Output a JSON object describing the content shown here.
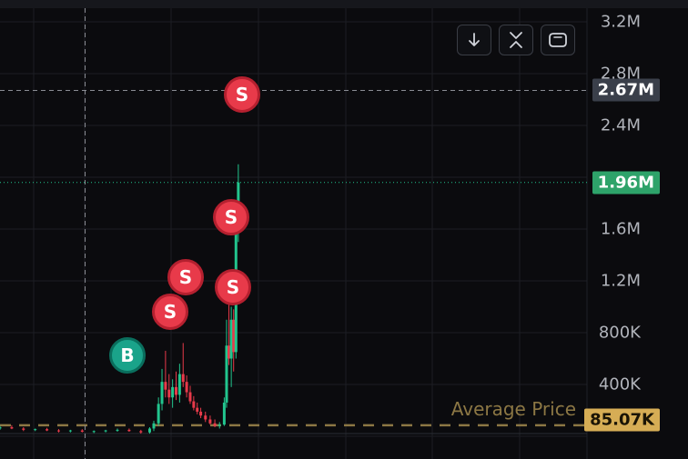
{
  "toolbar": {
    "buttons": [
      {
        "name": "scroll-down-button",
        "icon": "arrow-down-icon"
      },
      {
        "name": "collapse-button",
        "icon": "collapse-chevrons-icon"
      },
      {
        "name": "fullscreen-button",
        "icon": "fullscreen-frame-icon"
      }
    ]
  },
  "colors": {
    "background": "#0b0b0e",
    "grid": "#1c1e24",
    "up": "#22c58e",
    "down": "#e83a4a",
    "sell_marker": "#e83a4a",
    "buy_marker": "#1aa38a",
    "current_price_tag": "#2ea36a",
    "crosshair_tag": "#3a3f4a",
    "average_tag": "#d6ad55",
    "average_line": "#8c7744"
  },
  "tags": {
    "crosshair_price": "2.67M",
    "current_price": "1.96M",
    "average_price": "85.07K",
    "average_label": "Average Price"
  },
  "chart_data": {
    "type": "candlestick",
    "y_axis": {
      "ticks": [
        {
          "label": "3.2M",
          "value": 3200000
        },
        {
          "label": "2.8M",
          "value": 2800000
        },
        {
          "label": "2.4M",
          "value": 2400000
        },
        {
          "label": "1.6M",
          "value": 1600000
        },
        {
          "label": "1.2M",
          "value": 1200000
        },
        {
          "label": "800K",
          "value": 800000
        },
        {
          "label": "400K",
          "value": 400000
        }
      ],
      "range": [
        0,
        3250000
      ]
    },
    "grid": true,
    "horizontal_lines": [
      {
        "kind": "crosshair",
        "value": 2670000
      },
      {
        "kind": "current",
        "value": 1960000
      },
      {
        "kind": "average",
        "value": 85070
      }
    ],
    "crosshair_x_fraction": 0.145,
    "markers": [
      {
        "type": "sell",
        "label": "S",
        "index": 0.41,
        "value": 2670000
      },
      {
        "type": "sell",
        "label": "S",
        "index": 0.392,
        "value": 1700000
      },
      {
        "type": "sell",
        "label": "S",
        "index": 0.395,
        "value": 1010000
      },
      {
        "type": "sell",
        "label": "S",
        "index": 0.315,
        "value": 1060000
      },
      {
        "type": "sell",
        "label": "S",
        "index": 0.29,
        "value": 880000
      },
      {
        "type": "buy",
        "label": "B",
        "index": 0.218,
        "value": 580000
      }
    ],
    "candles": [
      [
        0.0,
        60000,
        80000,
        50000,
        70000
      ],
      [
        0.02,
        70000,
        85000,
        55000,
        60000
      ],
      [
        0.04,
        60000,
        70000,
        40000,
        50000
      ],
      [
        0.06,
        50000,
        60000,
        40000,
        55000
      ],
      [
        0.08,
        55000,
        65000,
        40000,
        45000
      ],
      [
        0.1,
        45000,
        55000,
        30000,
        40000
      ],
      [
        0.12,
        40000,
        50000,
        30000,
        45000
      ],
      [
        0.14,
        45000,
        55000,
        30000,
        35000
      ],
      [
        0.16,
        35000,
        45000,
        25000,
        40000
      ],
      [
        0.18,
        40000,
        50000,
        30000,
        45000
      ],
      [
        0.2,
        45000,
        60000,
        35000,
        50000
      ],
      [
        0.22,
        50000,
        60000,
        35000,
        40000
      ],
      [
        0.24,
        40000,
        50000,
        20000,
        30000
      ],
      [
        0.255,
        30000,
        70000,
        20000,
        60000
      ],
      [
        0.262,
        60000,
        120000,
        40000,
        100000
      ],
      [
        0.27,
        100000,
        300000,
        80000,
        250000
      ],
      [
        0.276,
        250000,
        520000,
        200000,
        420000
      ],
      [
        0.282,
        420000,
        660000,
        300000,
        360000
      ],
      [
        0.288,
        360000,
        480000,
        250000,
        300000
      ],
      [
        0.294,
        300000,
        440000,
        220000,
        380000
      ],
      [
        0.3,
        380000,
        500000,
        280000,
        320000
      ],
      [
        0.306,
        320000,
        560000,
        260000,
        480000
      ],
      [
        0.312,
        480000,
        720000,
        380000,
        420000
      ],
      [
        0.318,
        420000,
        470000,
        300000,
        340000
      ],
      [
        0.324,
        340000,
        390000,
        250000,
        270000
      ],
      [
        0.33,
        270000,
        310000,
        200000,
        220000
      ],
      [
        0.336,
        220000,
        260000,
        170000,
        190000
      ],
      [
        0.342,
        190000,
        220000,
        140000,
        160000
      ],
      [
        0.35,
        160000,
        190000,
        110000,
        130000
      ],
      [
        0.358,
        130000,
        160000,
        90000,
        100000
      ],
      [
        0.366,
        100000,
        130000,
        70000,
        80000
      ],
      [
        0.374,
        80000,
        110000,
        60000,
        90000
      ],
      [
        0.382,
        90000,
        300000,
        80000,
        260000
      ],
      [
        0.386,
        260000,
        900000,
        220000,
        700000
      ],
      [
        0.39,
        700000,
        1050000,
        550000,
        600000
      ],
      [
        0.394,
        600000,
        1000000,
        380000,
        900000
      ],
      [
        0.398,
        900000,
        980000,
        500000,
        650000
      ],
      [
        0.402,
        650000,
        1700000,
        600000,
        1650000
      ],
      [
        0.406,
        1650000,
        2100000,
        1500000,
        1960000
      ]
    ]
  }
}
